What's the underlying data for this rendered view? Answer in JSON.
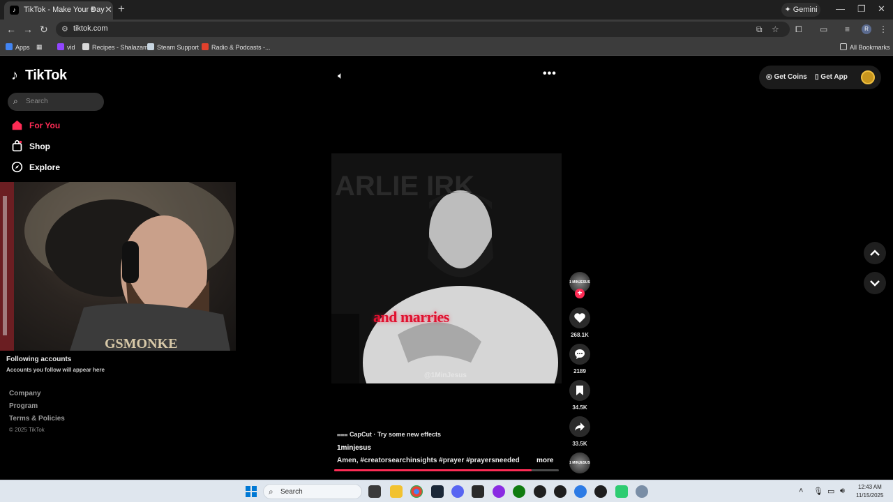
{
  "browser": {
    "tab": {
      "title": "TikTok - Make Your Day",
      "favicon": "tiktok-logo-icon"
    },
    "gemini_label": "Gemini",
    "url": "tiktok.com",
    "bookmarks": [
      {
        "label": "Apps",
        "icon": "apps-grid-icon"
      },
      {
        "label": "vid",
        "icon": "twitch-icon"
      },
      {
        "label": "Recipes - Shalazam",
        "icon": "chef-hat-icon"
      },
      {
        "label": "Steam Support",
        "icon": "steam-icon"
      },
      {
        "label": "Radio & Podcasts -...",
        "icon": "radio-icon"
      }
    ],
    "all_bookmarks_label": "All Bookmarks",
    "profile_initial": "R"
  },
  "tiktok": {
    "logo_text": "TikTok",
    "search_placeholder": "Search",
    "nav": [
      {
        "label": "For You",
        "icon": "home-icon",
        "active": true
      },
      {
        "label": "Shop",
        "icon": "shopping-bag-icon",
        "active": false
      },
      {
        "label": "Explore",
        "icon": "compass-icon",
        "active": false
      }
    ],
    "following_title": "Following accounts",
    "following_subtitle": "Accounts you follow will appear here",
    "footer_links": [
      "Company",
      "Program",
      "Terms & Policies"
    ],
    "copyright": "© 2025 TikTok",
    "top_right": {
      "get_coins": "Get Coins",
      "get_app": "Get App"
    },
    "video": {
      "caption_overlay": "and marries",
      "watermark": "@1MinJesus",
      "background_text": "ARLIE IRK",
      "capcut_promo": "CapCut · Try some new effects",
      "author": "1minjesus",
      "description": "Amen,  #creatorsearchinsights  #prayer  #prayersneeded  ...",
      "more_label": "more",
      "progress": 0.88,
      "avatar_text": "1 MINJESUS"
    },
    "actions": {
      "likes": "268.1K",
      "comments": "2189",
      "saves": "34.5K",
      "shares": "33.5K"
    },
    "accent_color": "#fe2c55"
  },
  "taskbar": {
    "search_label": "Search",
    "time": "12:43 AM",
    "date": "11/15/2025"
  }
}
